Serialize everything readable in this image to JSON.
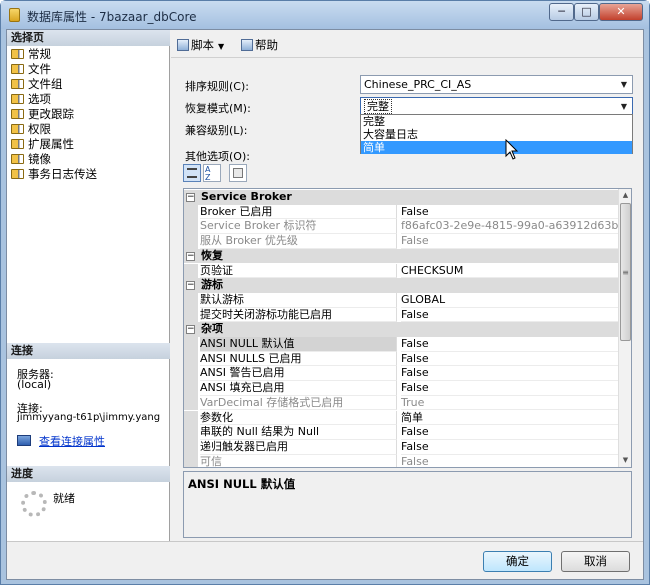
{
  "window": {
    "title": "数据库属性 - 7bazaar_dbCore",
    "min_label": "─",
    "max_label": "□",
    "close_label": "✕"
  },
  "left": {
    "select_page_title": "选择页",
    "pages": [
      "常规",
      "文件",
      "文件组",
      "选项",
      "更改跟踪",
      "权限",
      "扩展属性",
      "镜像",
      "事务日志传送"
    ],
    "connection_title": "连接",
    "server_label": "服务器:",
    "server_value": "(local)",
    "connection_label": "连接:",
    "connection_value": "jimmyyang-t61p\\jimmy.yang",
    "connection_link": "查看连接属性",
    "progress_title": "进度",
    "progress_status": "就绪"
  },
  "toolbar": {
    "script_label": "脚本",
    "help_label": "帮助"
  },
  "fields": {
    "collation_label": "排序规则(C):",
    "collation_value": "Chinese_PRC_CI_AS",
    "recovery_label": "恢复模式(M):",
    "recovery_value": "完整",
    "recovery_options": [
      "完整",
      "大容量日志",
      "简单"
    ],
    "recovery_highlighted": "简单",
    "compat_label": "兼容级别(L):",
    "other_label": "其他选项(O):"
  },
  "grid": {
    "rows": [
      {
        "type": "category",
        "text": "Service Broker"
      },
      {
        "type": "prop",
        "name": "Broker 已启用",
        "value": "False"
      },
      {
        "type": "prop",
        "name": "Service Broker 标识符",
        "value": "f86afc03-2e9e-4815-99a0-a63912d63b58",
        "readonly": true
      },
      {
        "type": "prop",
        "name": "服从 Broker 优先级",
        "value": "False",
        "readonly": true
      },
      {
        "type": "category",
        "text": "恢复"
      },
      {
        "type": "prop",
        "name": "页验证",
        "value": "CHECKSUM"
      },
      {
        "type": "category",
        "text": "游标"
      },
      {
        "type": "prop",
        "name": "默认游标",
        "value": "GLOBAL"
      },
      {
        "type": "prop",
        "name": "提交时关闭游标功能已启用",
        "value": "False"
      },
      {
        "type": "category",
        "text": "杂项"
      },
      {
        "type": "prop",
        "name": "ANSI NULL 默认值",
        "value": "False",
        "selected": true
      },
      {
        "type": "prop",
        "name": "ANSI NULLS 已启用",
        "value": "False"
      },
      {
        "type": "prop",
        "name": "ANSI 警告已启用",
        "value": "False"
      },
      {
        "type": "prop",
        "name": "ANSI 填充已启用",
        "value": "False"
      },
      {
        "type": "prop",
        "name": "VarDecimal 存储格式已启用",
        "value": "True",
        "readonly": true
      },
      {
        "type": "prop",
        "name": "参数化",
        "value": "简单"
      },
      {
        "type": "prop",
        "name": "串联的 Null 结果为 Null",
        "value": "False"
      },
      {
        "type": "prop",
        "name": "递归触发器已启用",
        "value": "False"
      },
      {
        "type": "prop",
        "name": "可信",
        "value": "False",
        "readonly": true
      }
    ]
  },
  "description": {
    "title": "ANSI NULL 默认值"
  },
  "buttons": {
    "ok": "确定",
    "cancel": "取消"
  }
}
